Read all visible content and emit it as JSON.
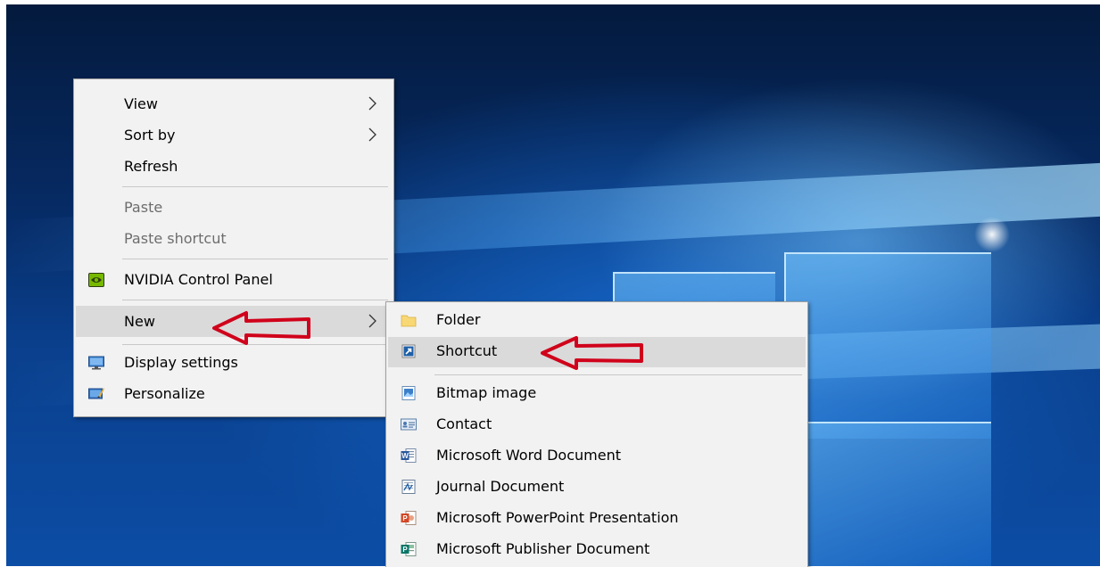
{
  "context_menu": {
    "items": [
      {
        "label": "View",
        "has_submenu": true
      },
      {
        "label": "Sort by",
        "has_submenu": true
      },
      {
        "label": "Refresh"
      },
      {
        "label": "Paste",
        "disabled": true
      },
      {
        "label": "Paste shortcut",
        "disabled": true
      },
      {
        "label": "NVIDIA Control Panel",
        "icon": "nvidia-icon"
      },
      {
        "label": "New",
        "has_submenu": true,
        "highlighted": true
      },
      {
        "label": "Display settings",
        "icon": "display-icon"
      },
      {
        "label": "Personalize",
        "icon": "personalize-icon"
      }
    ]
  },
  "new_submenu": {
    "items": [
      {
        "label": "Folder",
        "icon": "folder-icon"
      },
      {
        "label": "Shortcut",
        "icon": "shortcut-icon",
        "highlighted": true
      },
      {
        "label": "Bitmap image",
        "icon": "bitmap-icon"
      },
      {
        "label": "Contact",
        "icon": "contact-icon"
      },
      {
        "label": "Microsoft Word Document",
        "icon": "word-icon"
      },
      {
        "label": "Journal Document",
        "icon": "journal-icon"
      },
      {
        "label": "Microsoft PowerPoint Presentation",
        "icon": "powerpoint-icon"
      },
      {
        "label": "Microsoft Publisher Document",
        "icon": "publisher-icon"
      }
    ]
  },
  "annotations": {
    "arrow_color": "#d0021b",
    "arrows": [
      "pointing-to-new",
      "pointing-to-shortcut"
    ]
  },
  "colors": {
    "menu_bg": "#f2f2f2",
    "hover_bg": "#dadada",
    "disabled_text": "#6d6d6d"
  }
}
